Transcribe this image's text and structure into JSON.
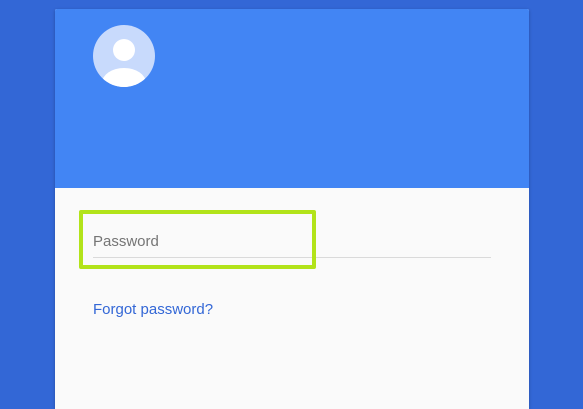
{
  "colors": {
    "background": "#3367d6",
    "header": "#4285f4",
    "card_body": "#fafafa",
    "avatar_bg": "#c8dafc",
    "avatar_figure": "#ffffff",
    "highlight": "#b2e31a",
    "link": "#3367d6"
  },
  "login": {
    "avatar_icon": "account-circle-icon",
    "password_field": {
      "placeholder": "Password",
      "value": ""
    },
    "forgot_password_label": "Forgot password?"
  }
}
